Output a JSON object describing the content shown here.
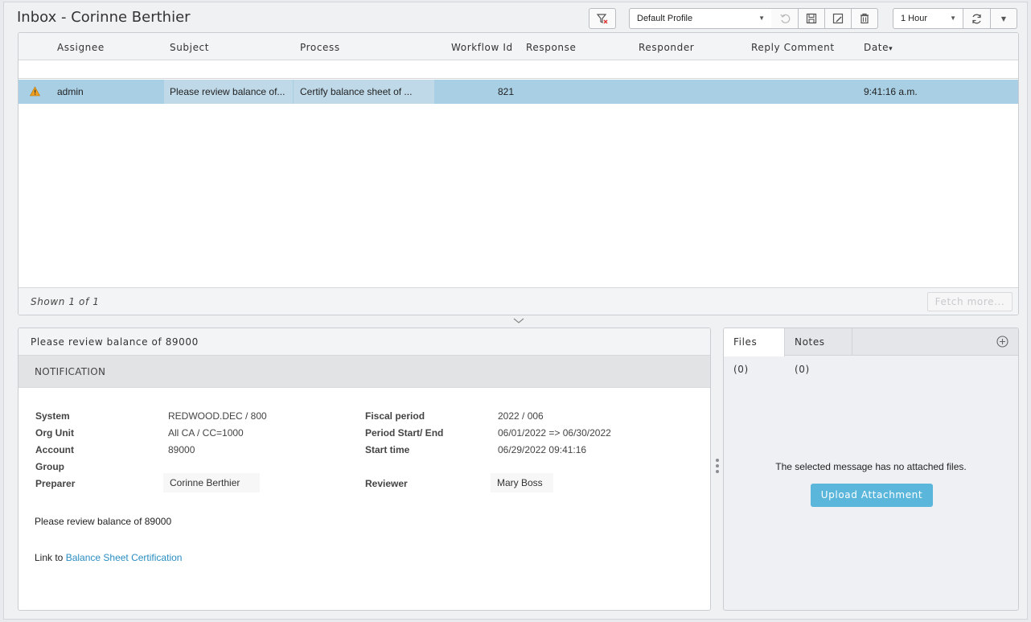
{
  "header": {
    "title": "Inbox - Corinne Berthier",
    "profile_select": "Default Profile",
    "interval_select": "1 Hour"
  },
  "grid": {
    "columns": [
      "Assignee",
      "Subject",
      "Process",
      "Workflow Id",
      "Response",
      "Responder",
      "Reply Comment",
      "Date"
    ],
    "sort_indicator": "▾",
    "rows": [
      {
        "assignee": "admin",
        "subject": "Please review balance of...",
        "process": "Certify balance sheet of ...",
        "workflow_id": "821",
        "response": "",
        "responder": "",
        "reply_comment": "",
        "date": "9:41:16 a.m."
      }
    ],
    "footer": {
      "shown": "Shown 1 of 1",
      "fetch_more": "Fetch more..."
    }
  },
  "detail": {
    "header": "Please review balance of 89000",
    "section": "NOTIFICATION",
    "fields_left": [
      {
        "label": "System",
        "value": "REDWOOD.DEC / 800"
      },
      {
        "label": "Org Unit",
        "value": "All CA / CC=1000"
      },
      {
        "label": "Account",
        "value": "89000"
      },
      {
        "label": "Group",
        "value": ""
      },
      {
        "label": "Preparer",
        "value": "Corinne Berthier"
      }
    ],
    "fields_right": [
      {
        "label": "Fiscal period",
        "value": "2022 / 006"
      },
      {
        "label": "Period Start/ End",
        "value": "06/01/2022 => 06/30/2022"
      },
      {
        "label": "Start time",
        "value": "06/29/2022 09:41:16"
      },
      {
        "label": "Reviewer",
        "value": "Mary Boss"
      }
    ],
    "message": "Please review balance of 89000",
    "link_prefix": "Link to ",
    "link_text": "Balance Sheet Certification"
  },
  "files_panel": {
    "tabs": [
      "Files (0)",
      "Notes (0)"
    ],
    "empty_message": "The selected message has no attached files.",
    "upload_label": "Upload Attachment"
  },
  "colors": {
    "selected_row": "#a8cfe3",
    "link": "#2a8dc2",
    "upload_button": "#5bb6dc",
    "warning": "#f0a020"
  }
}
